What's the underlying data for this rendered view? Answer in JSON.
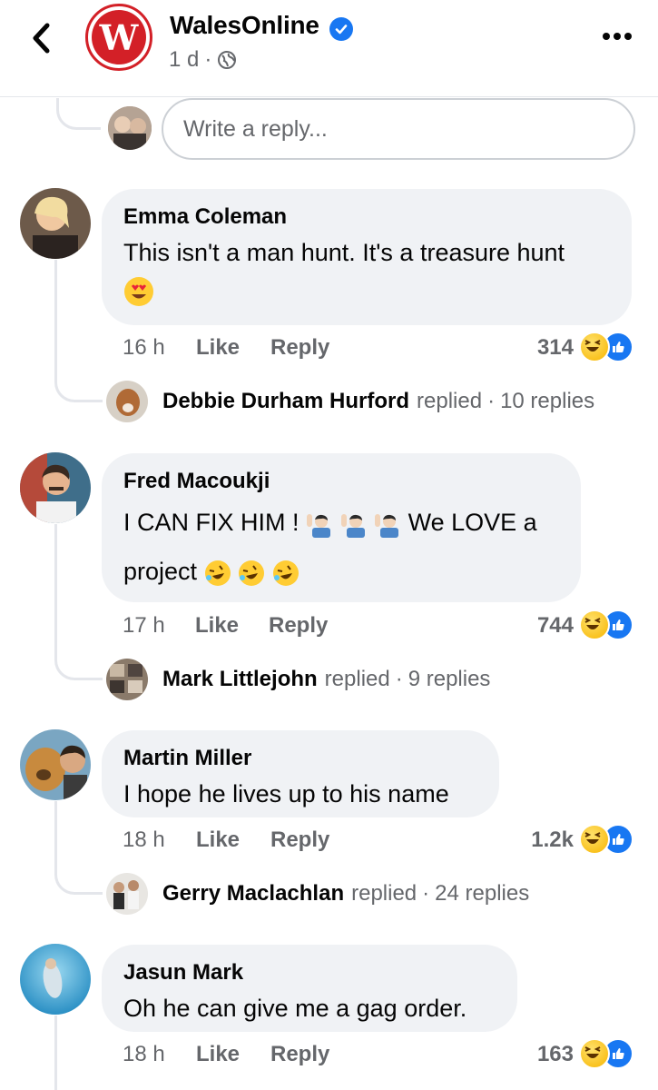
{
  "header": {
    "page_name": "WalesOnline",
    "logo_letter": "W",
    "time": "1 d",
    "dot": "·",
    "icons": [
      "back-arrow-icon",
      "verified-badge-icon",
      "globe-icon",
      "more-icon"
    ]
  },
  "reply_bar": {
    "placeholder": "Write a reply..."
  },
  "comments": [
    {
      "author": "Emma Coleman",
      "text": "This isn't a man hunt. It's a treasure hunt",
      "emoji_line": "heart-eyes-emoji",
      "time": "16 h",
      "like_label": "Like",
      "reply_label": "Reply",
      "reaction_count": "314",
      "reactions": [
        "haha",
        "like"
      ],
      "replied_by": "Debbie Durham Hurford",
      "replied_word": "replied",
      "reply_count": "10 replies"
    },
    {
      "author": "Fred Macoukji",
      "text_line1": "I CAN FIX HIM !",
      "text_line1_end": "We LOVE a",
      "text_line2": "project",
      "emojis_line1": [
        "man-raising-hand-emoji",
        "man-raising-hand-emoji",
        "man-raising-hand-emoji"
      ],
      "emojis_line2": [
        "rolling-on-floor-laughing-emoji",
        "rolling-on-floor-laughing-emoji",
        "rolling-on-floor-laughing-emoji"
      ],
      "time": "17 h",
      "like_label": "Like",
      "reply_label": "Reply",
      "reaction_count": "744",
      "reactions": [
        "haha",
        "like"
      ],
      "replied_by": "Mark Littlejohn",
      "replied_word": "replied",
      "reply_count": "9 replies"
    },
    {
      "author": "Martin Miller",
      "text": "I hope he lives up to his name",
      "time": "18 h",
      "like_label": "Like",
      "reply_label": "Reply",
      "reaction_count": "1.2k",
      "reactions": [
        "haha",
        "like"
      ],
      "replied_by": "Gerry Maclachlan",
      "replied_word": "replied",
      "reply_count": "24 replies"
    },
    {
      "author": "Jasun Mark",
      "text": "Oh he can give me a gag order.",
      "time": "18 h",
      "like_label": "Like",
      "reply_label": "Reply",
      "reaction_count": "163",
      "reactions": [
        "haha",
        "like"
      ]
    }
  ],
  "colors": {
    "brand_red": "#d32027",
    "facebook_blue": "#1877f2",
    "bubble_bg": "#f0f2f5",
    "meta_gray": "#65676b"
  }
}
